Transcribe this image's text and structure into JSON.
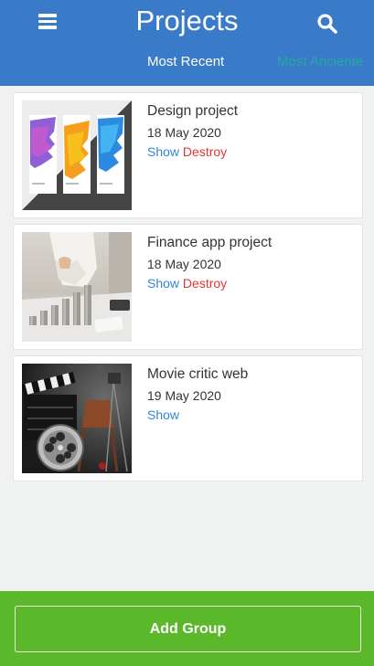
{
  "header": {
    "title": "Projects",
    "tab_recent": "Most Recent",
    "tab_old": "Most Anciente",
    "icons": {
      "menu": "menu-icon",
      "search": "search-icon"
    }
  },
  "projects": [
    {
      "title": "Design project",
      "date": "18 May 2020",
      "show": "Show",
      "destroy": "Destroy",
      "thumbnail": "design-banners-image"
    },
    {
      "title": "Finance app project",
      "date": "18 May 2020",
      "show": "Show",
      "destroy": "Destroy",
      "thumbnail": "coin-stacks-image"
    },
    {
      "title": "Movie critic web",
      "date": "19 May 2020",
      "show": "Show",
      "thumbnail": "film-clapper-image"
    }
  ],
  "footer": {
    "add_label": "Add Group"
  },
  "colors": {
    "header": "#3a7bc9",
    "tab_inactive": "#26a8a0",
    "show_link": "#2f86d6",
    "destroy_link": "#e0363a",
    "footer": "#5cb82b",
    "background": "#f0f1f1"
  }
}
